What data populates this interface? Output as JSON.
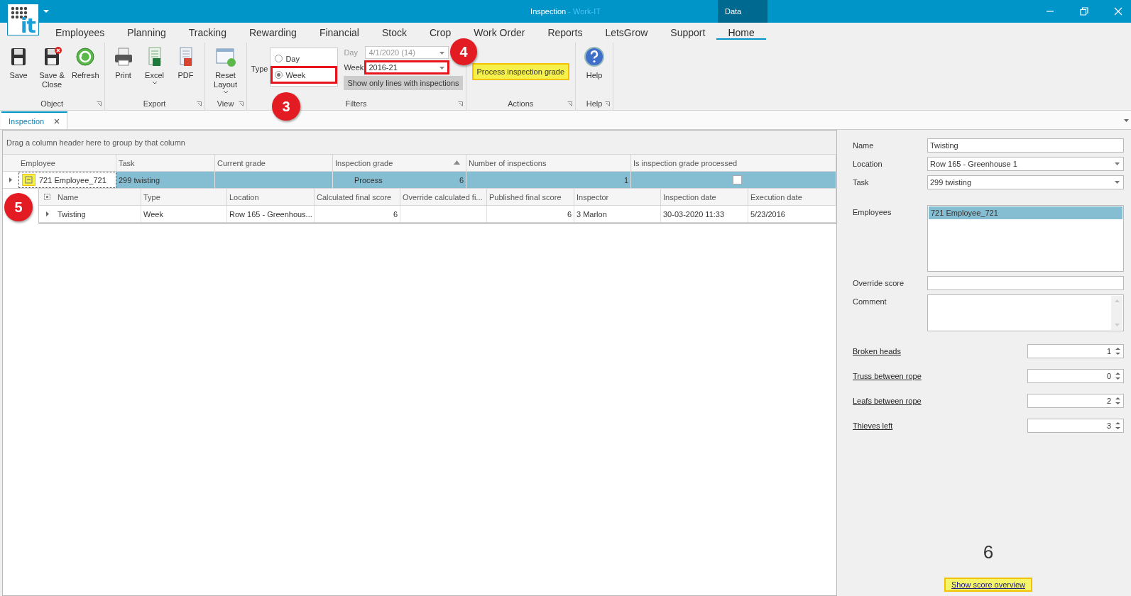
{
  "window": {
    "logo_text": "it",
    "title": "Inspection",
    "app_name": " - Work-IT",
    "context_tab": "Data"
  },
  "menu": [
    {
      "label": "Employees",
      "selected": false
    },
    {
      "label": "Planning",
      "selected": false
    },
    {
      "label": "Tracking",
      "selected": false
    },
    {
      "label": "Rewarding",
      "selected": false
    },
    {
      "label": "Financial",
      "selected": false
    },
    {
      "label": "Stock",
      "selected": false
    },
    {
      "label": "Crop",
      "selected": false
    },
    {
      "label": "Work Order",
      "selected": false
    },
    {
      "label": "Reports",
      "selected": false
    },
    {
      "label": "LetsGrow",
      "selected": false
    },
    {
      "label": "Support",
      "selected": false
    },
    {
      "label": "Home",
      "selected": true
    }
  ],
  "ribbon": {
    "groups": [
      {
        "kind": "buttons",
        "title": "Object",
        "buttons": [
          {
            "kind": "save",
            "label": "Save",
            "dropdown": false
          },
          {
            "kind": "save_close",
            "label": "Save & Close",
            "dropdown": false
          },
          {
            "kind": "refresh",
            "label": "Refresh",
            "dropdown": false
          }
        ]
      },
      {
        "kind": "buttons",
        "title": "Export",
        "buttons": [
          {
            "kind": "print",
            "label": "Print",
            "dropdown": false
          },
          {
            "kind": "excel",
            "label": "Excel",
            "dropdown": true
          },
          {
            "kind": "pdf",
            "label": "PDF",
            "dropdown": false
          }
        ]
      },
      {
        "kind": "buttons",
        "title": "View",
        "buttons": [
          {
            "kind": "layout",
            "label": "Reset Layout",
            "dropdown": true
          }
        ]
      },
      {
        "kind": "filters",
        "title": "Filters",
        "type_label": "Type",
        "radios": [
          {
            "label": "Day",
            "selected": false,
            "outlined": false
          },
          {
            "label": "Week",
            "selected": true,
            "outlined": true
          }
        ],
        "day": {
          "label": "Day",
          "value": "4/1/2020 (14)",
          "disabled": true,
          "outlined": false
        },
        "week": {
          "label": "Week",
          "value": "2016-21",
          "disabled": false,
          "outlined": true
        },
        "toggle": {
          "label": "Show only lines with inspections",
          "on": true
        }
      },
      {
        "kind": "actions",
        "title": "Actions",
        "buttons": [
          {
            "label": "Process inspection grade",
            "highlighted": true
          }
        ]
      },
      {
        "kind": "buttons",
        "title": "Help",
        "buttons": [
          {
            "kind": "help",
            "label": "Help",
            "dropdown": false
          }
        ]
      }
    ]
  },
  "callouts": [
    {
      "label": "3"
    },
    {
      "label": "4"
    },
    {
      "label": "5"
    }
  ],
  "document_tabs": [
    {
      "label": "Inspection",
      "selected": true
    }
  ],
  "grid": {
    "group_hint": "Drag a column header here to group by that column",
    "columns": [
      {
        "label": "Employee",
        "sorted": false
      },
      {
        "label": "Task",
        "sorted": false
      },
      {
        "label": "Current grade",
        "sorted": false
      },
      {
        "label": "Inspection grade",
        "sorted": true
      },
      {
        "label": "Number of inspections",
        "sorted": false
      },
      {
        "label": "Is inspection grade processed",
        "sorted": false
      }
    ],
    "rows": [
      {
        "selected": true,
        "expanded": true,
        "expander_highlighted": true,
        "employee": "721 Employee_721",
        "task": "299 twisting",
        "grade_action": "Process",
        "inspection_grade": "6",
        "number_of_inspections": "1",
        "processed": false,
        "detail": {
          "columns": [
            "Name",
            "Type",
            "Location",
            "Calculated final score",
            "Override calculated fi...",
            "Published final score",
            "Inspector",
            "Inspection date",
            "Execution date"
          ],
          "rows": [
            {
              "cells": [
                "Twisting",
                "Week",
                "Row 165 - Greenhous...",
                "6",
                null,
                "6",
                "3 Marlon",
                "30-03-2020 11:33",
                "5/23/2016"
              ]
            }
          ]
        }
      }
    ]
  },
  "form": {
    "name": {
      "label": "Name",
      "value": "Twisting"
    },
    "location": {
      "label": "Location",
      "value": "Row 165 - Greenhouse 1"
    },
    "task": {
      "label": "Task",
      "value": "299 twisting"
    },
    "employees": {
      "label": "Employees",
      "items": [
        {
          "label": "721 Employee_721",
          "selected": true
        }
      ]
    },
    "override_score": {
      "label": "Override score"
    },
    "comment": {
      "label": "Comment"
    },
    "counters": [
      {
        "label": "Broken heads",
        "value": "1"
      },
      {
        "label": "Truss between rope",
        "value": "0"
      },
      {
        "label": "Leafs between rope",
        "value": "2"
      },
      {
        "label": "Thieves left",
        "value": "3"
      }
    ],
    "score": "6",
    "overview_link": {
      "label": "Show score overview",
      "highlighted": true
    }
  }
}
